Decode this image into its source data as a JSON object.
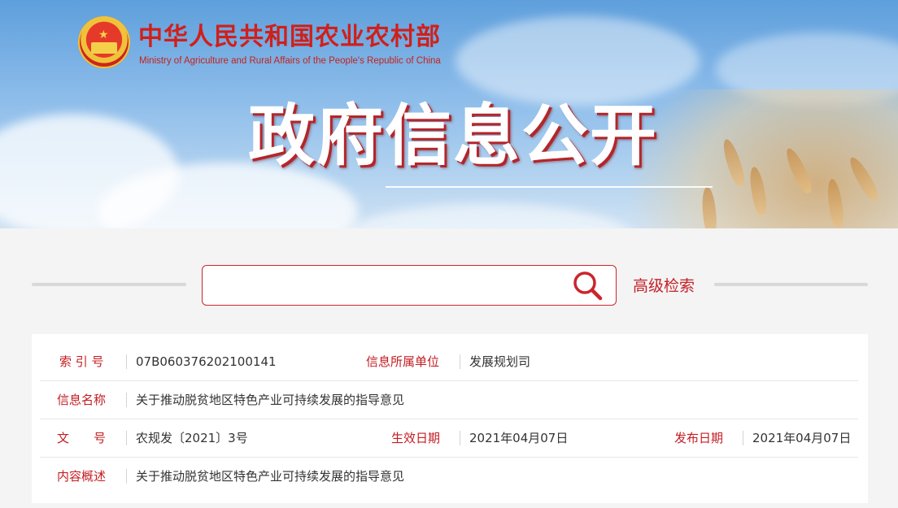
{
  "header": {
    "ministry_name_cn": "中华人民共和国农业农村部",
    "ministry_name_en": "Ministry of Agriculture and Rural Affairs of the People's Republic of China",
    "page_title": "政府信息公开",
    "emblem_icon": "national-emblem-icon"
  },
  "search": {
    "placeholder": "",
    "value": "",
    "advanced_label": "高级检索",
    "accent_color": "#c9262d"
  },
  "info": {
    "index_label": "索 引 号",
    "index_value": "07B060376202100141",
    "unit_label": "信息所属单位",
    "unit_value": "发展规划司",
    "name_label": "信息名称",
    "name_value": "关于推动脱贫地区特色产业可持续发展的指导意见",
    "doc_no_label": "文　　号",
    "doc_no_value": "农规发〔2021〕3号",
    "effective_label": "生效日期",
    "effective_value": "2021年04月07日",
    "publish_label": "发布日期",
    "publish_value": "2021年04月07日",
    "summary_label": "内容概述",
    "summary_value": "关于推动脱贫地区特色产业可持续发展的指导意见"
  }
}
